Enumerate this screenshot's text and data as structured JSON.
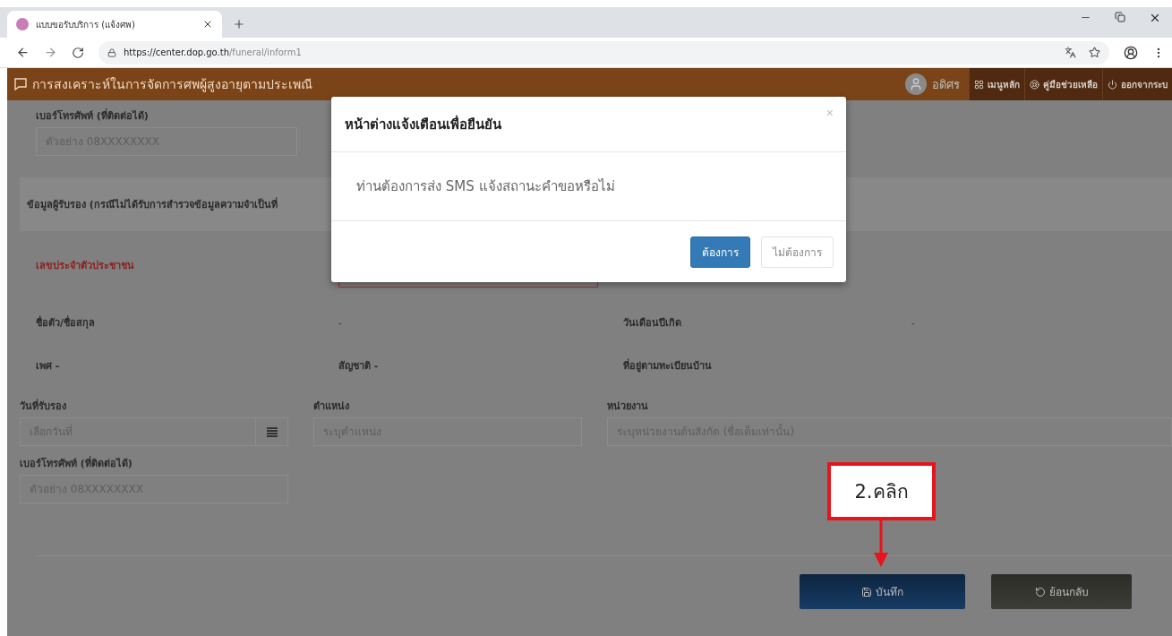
{
  "browser": {
    "tab_title": "แบบขอรับบริการ (แจ้งศพ)",
    "url_host": "https://center.dop.go.th",
    "url_path": "/funeral/inform1"
  },
  "header": {
    "title": "การสงเคราะห์ในการจัดการศพผู้สูงอายุตามประเพณี",
    "user": "อดิศร",
    "nav": [
      {
        "kind": "grid",
        "label": "เมนูหลัก"
      },
      {
        "kind": "help",
        "label": "คู่มือช่วยเหลือ"
      },
      {
        "kind": "power",
        "label": "ออกจากระบ"
      }
    ]
  },
  "form": {
    "top_phone": {
      "label": "เบอร์โทรศัพท์ (ที่ติดต่อได้)",
      "placeholder": "ตัวอย่าง 08XXXXXXXX"
    },
    "section_title": "ข้อมูลผู้รับรอง (กรณีไม่ได้รับการสำรวจข้อมูลความจำเป็นที่",
    "id_label": "เลขประจำตัวประชาชน",
    "details": [
      {
        "label": "ชื่อตัว/ชื่อสกุล",
        "value": "-"
      },
      {
        "label": "วันเดือนปีเกิด",
        "value": "-"
      }
    ],
    "details_2": [
      "เพศ -",
      "สัญชาติ -",
      "ที่อยู่ตามทะเบียนบ้าน"
    ],
    "certify_fields": [
      {
        "kind": "date",
        "label": "วันที่รับรอง",
        "placeholder": "เลือกวันที่"
      },
      {
        "kind": "text",
        "label": "ตำแหน่ง",
        "placeholder": "ระบุตำแหน่ง"
      },
      {
        "kind": "text",
        "label": "หน่วยงาน",
        "placeholder": "ระบุหน่วยงานต้นสังกัด (ชื่อเต็มเท่านั้น)"
      }
    ],
    "phone": {
      "label": "เบอร์โทรศัพท์ (ที่ติดต่อได้)",
      "placeholder": "ตัวอย่าง 08XXXXXXXX"
    },
    "buttons": [
      {
        "kind": "save",
        "label": "บันทึก"
      },
      {
        "kind": "back",
        "label": "ย้อนกลับ"
      }
    ]
  },
  "annotation": {
    "label": "2.คลิก"
  },
  "modal": {
    "title": "หน้าต่างแจ้งเตือนเพื่อยืนยัน",
    "close": "×",
    "message": "ท่านต้องการส่ง SMS แจ้งสถานะคำขอหรือไม่",
    "buttons": [
      {
        "kind": "primary",
        "label": "ต้องการ"
      },
      {
        "kind": "default",
        "label": "ไม่ต้องการ"
      }
    ]
  }
}
